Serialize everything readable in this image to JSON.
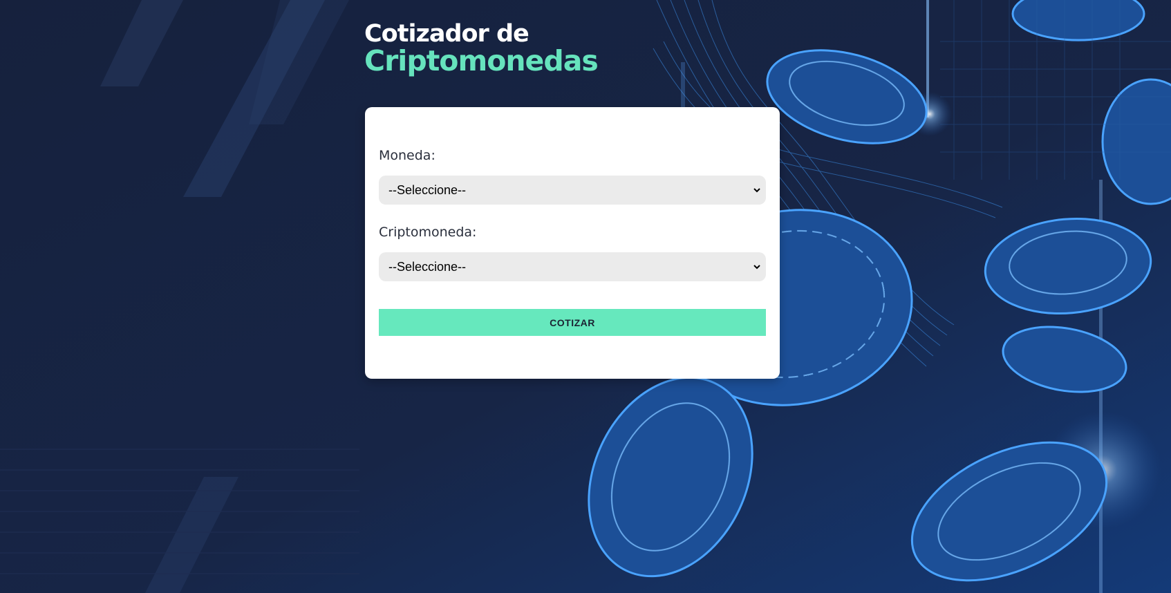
{
  "header": {
    "title_line1": "Cotizador de",
    "title_line2": "Criptomonedas"
  },
  "form": {
    "currency_label": "Moneda:",
    "currency_selected": "--Seleccione--",
    "crypto_label": "Criptomoneda:",
    "crypto_selected": "--Seleccione--",
    "submit_label": "COTIZAR"
  },
  "colors": {
    "background": "#172240",
    "accent": "#66e3bd",
    "button": "#66e8bd",
    "card": "#ffffff"
  },
  "icons": [
    "chevron-down-icon"
  ]
}
